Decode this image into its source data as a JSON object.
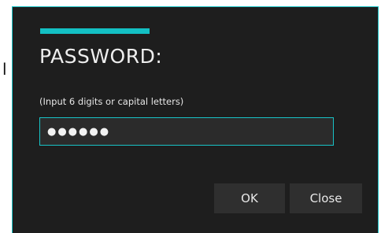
{
  "background": {
    "partial_text": "l"
  },
  "dialog": {
    "title": "PASSWORD:",
    "hint": "(Input 6 digits or capital letters)",
    "password_value": "●●●●●●",
    "ok_label": "OK",
    "close_label": "Close",
    "accent_color": "#13c0c4",
    "background_color": "#1e1e1e"
  }
}
